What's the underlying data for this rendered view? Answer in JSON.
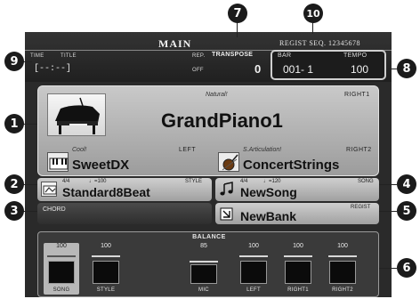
{
  "header": {
    "title": "MAIN",
    "regist_seq": "REGIST SEQ. 12345678",
    "time_label": "TIME",
    "title_label": "TITLE",
    "rep_label": "REP.",
    "off_label": "OFF",
    "time_value": "[--:--]",
    "transpose_label": "TRANSPOSE",
    "transpose_value": "0",
    "bar_label": "BAR",
    "tempo_label": "TEMPO",
    "bar_value": "001-  1",
    "tempo_value": "100"
  },
  "voices": {
    "right1": {
      "category": "Natural!",
      "part": "RIGHT1",
      "name": "GrandPiano1"
    },
    "left": {
      "category": "Cool!",
      "part": "LEFT",
      "name": "SweetDX"
    },
    "right2": {
      "category": "S.Articulation!",
      "part": "RIGHT2",
      "name": "ConcertStrings"
    }
  },
  "style": {
    "time_sig": "4/4",
    "tempo": "♩=100",
    "label": "STYLE",
    "name": "Standard8Beat"
  },
  "song": {
    "time_sig": "4/4",
    "tempo": "♩=120",
    "label": "SONG",
    "name": "NewSong"
  },
  "chord": {
    "label": "CHORD"
  },
  "regist": {
    "label": "REGIST",
    "name": "NewBank"
  },
  "balance": {
    "title": "BALANCE",
    "channels": [
      {
        "name": "SONG",
        "value": "100"
      },
      {
        "name": "STYLE",
        "value": "100"
      },
      {
        "name": "MIC",
        "value": "85"
      },
      {
        "name": "LEFT",
        "value": "100"
      },
      {
        "name": "RIGHT1",
        "value": "100"
      },
      {
        "name": "RIGHT2",
        "value": "100"
      }
    ]
  },
  "callouts": [
    "1",
    "2",
    "3",
    "4",
    "5",
    "6",
    "7",
    "8",
    "9",
    "10"
  ]
}
